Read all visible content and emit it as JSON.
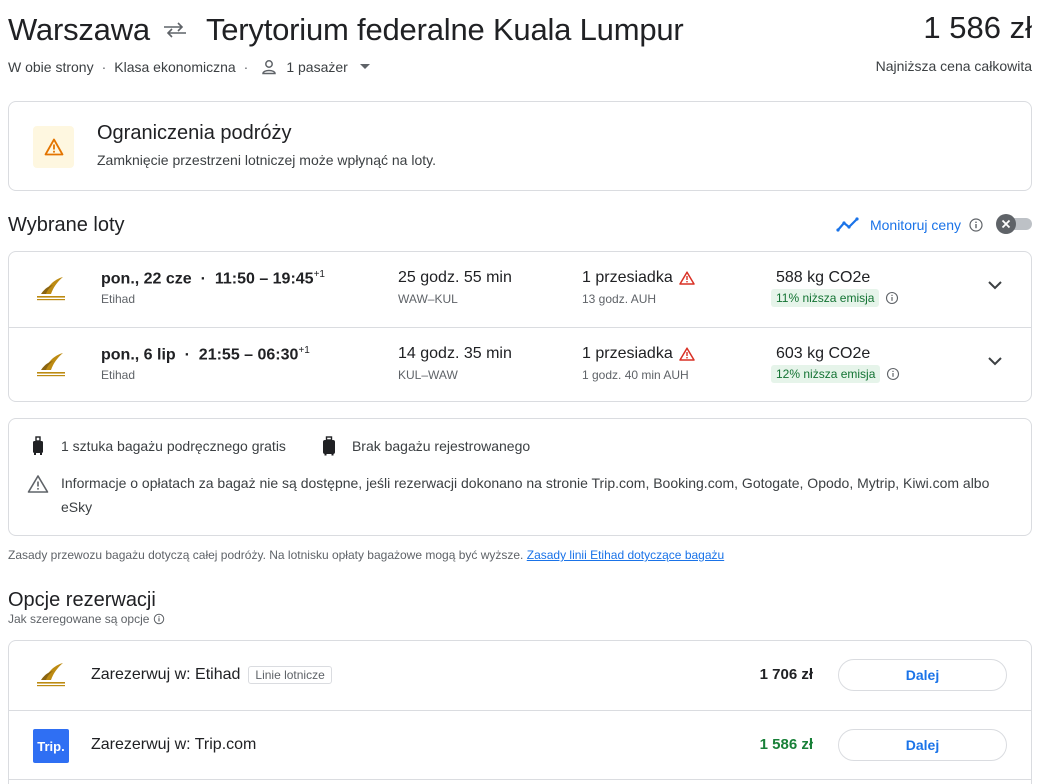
{
  "header": {
    "origin": "Warszawa",
    "destination": "Terytorium federalne Kuala Lumpur",
    "price": "1 586 zł",
    "trip_type": "W obie strony",
    "cabin": "Klasa ekonomiczna",
    "passengers": "1 pasażer",
    "price_label": "Najniższa cena całkowita"
  },
  "restriction": {
    "title": "Ograniczenia podróży",
    "text": "Zamknięcie przestrzeni lotniczej może wpłynąć na loty."
  },
  "selected": {
    "title": "Wybrane loty",
    "monitor_label": "Monitoruj ceny"
  },
  "flights": [
    {
      "date": "pon., 22 cze",
      "times": "11:50 – 19:45",
      "day_offset": "+1",
      "airline": "Etihad",
      "duration": "25 godz. 55 min",
      "route": "WAW–KUL",
      "stops": "1 przesiadka",
      "stop_info": "13 godz. AUH",
      "co2": "588 kg CO2e",
      "emission": "11% niższa emisja"
    },
    {
      "date": "pon., 6 lip",
      "times": "21:55 – 06:30",
      "day_offset": "+1",
      "airline": "Etihad",
      "duration": "14 godz. 35 min",
      "route": "KUL–WAW",
      "stops": "1 przesiadka",
      "stop_info": "1 godz. 40 min AUH",
      "co2": "603 kg CO2e",
      "emission": "12% niższa emisja"
    }
  ],
  "baggage": {
    "carry_on": "1 sztuka bagażu podręcznego gratis",
    "checked": "Brak bagażu rejestrowanego",
    "info": "Informacje o opłatach za bagaż nie są dostępne, jeśli rezerwacji dokonano na stronie Trip.com, Booking.com, Gotogate, Opodo, Mytrip, Kiwi.com albo eSky",
    "policy_text": "Zasady przewozu bagażu dotyczą całej podróży. Na lotnisku opłaty bagażowe mogą być wyższe.",
    "policy_link": "Zasady linii Etihad dotyczące bagażu"
  },
  "booking": {
    "title": "Opcje rezerwacji",
    "ranked_label": "Jak szeregowane są opcje",
    "options": [
      {
        "name": "Zarezerwuj w: Etihad",
        "tag": "Linie lotnicze",
        "price": "1 706 zł",
        "button": "Dalej"
      },
      {
        "name": "Zarezerwuj w: Trip.com",
        "logo_text": "Trip.",
        "price": "1 586 zł",
        "button": "Dalej"
      }
    ]
  },
  "colors": {
    "accent": "#1a73e8",
    "warning": "#e37400",
    "error": "#d93025",
    "green": "#137333"
  }
}
